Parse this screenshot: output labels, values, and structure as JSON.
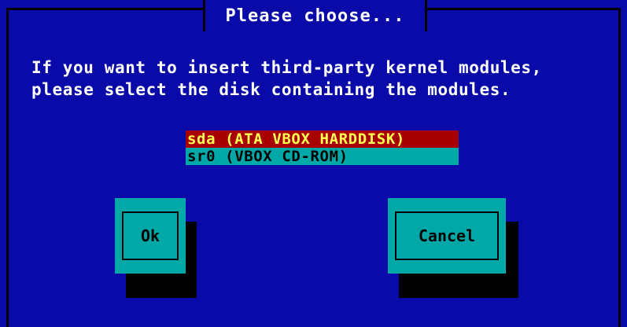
{
  "dialog": {
    "title": "Please choose...",
    "message_line1": "If you want to insert third-party kernel modules,",
    "message_line2": "please select the disk containing the modules."
  },
  "disk_list": {
    "items": [
      {
        "label": "sda (ATA VBOX HARDDISK)",
        "selected": true
      },
      {
        "label": "sr0 (VBOX CD-ROM)",
        "selected": false
      }
    ]
  },
  "buttons": {
    "ok_label": "Ok",
    "cancel_label": "Cancel"
  },
  "colors": {
    "background": "#0a0aa8",
    "selected_bg": "#a80000",
    "selected_fg": "#ffff54",
    "item_bg": "#00a8a8",
    "button_bg": "#00a8a8",
    "text": "#ffffff"
  }
}
